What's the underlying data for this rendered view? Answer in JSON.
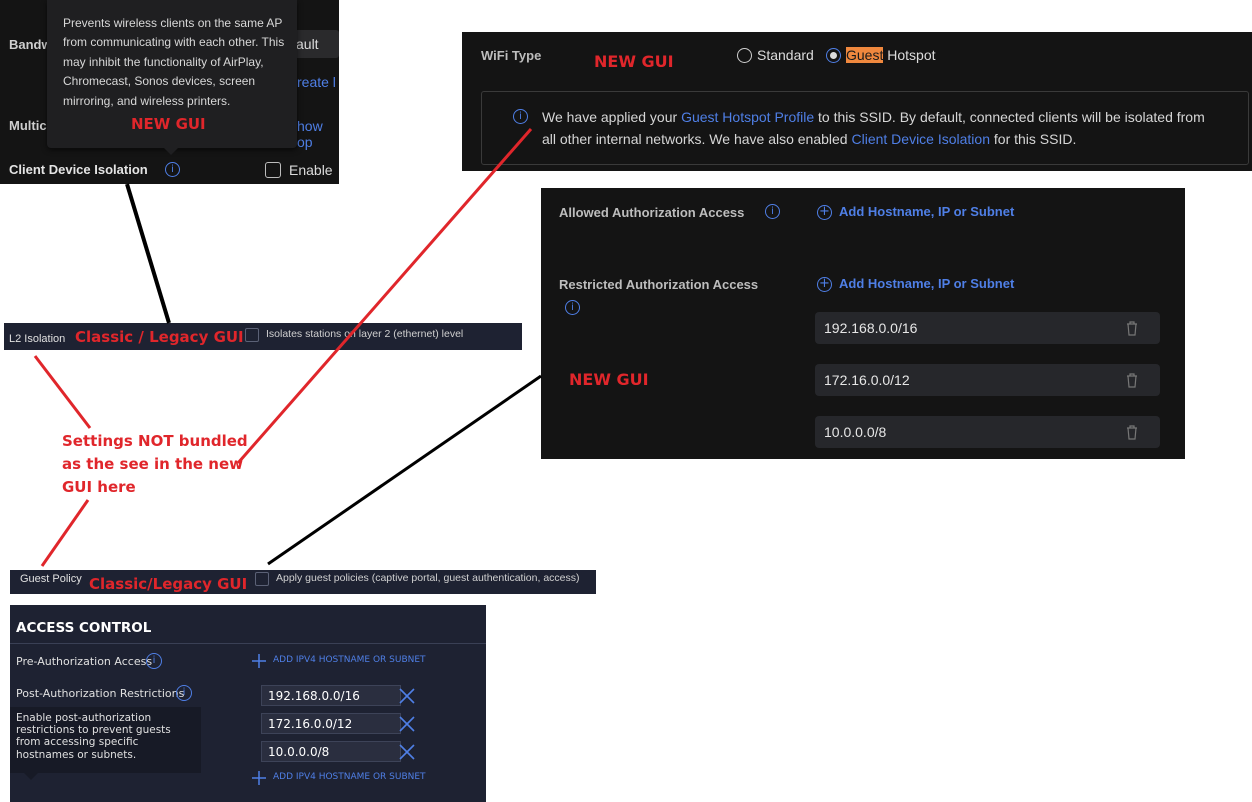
{
  "tooltip": {
    "text": "Prevents wireless clients on the same AP from communicating with each other. This may inhibit the functionality of AirPlay, Chromecast, Sonos devices, screen mirroring, and wireless printers.",
    "annotation": "NEW GUI"
  },
  "new_gui_isolation": {
    "bandwidth_label_partial": "Bandw",
    "default_partial": "ault",
    "create_partial": "reate l",
    "multicast_label_partial": "Multic",
    "show_partial": "how op",
    "client_isolation_label": "Client Device Isolation",
    "enable_label": "Enable"
  },
  "wifi_type": {
    "label": "WiFi Type",
    "annotation": "NEW GUI",
    "option_standard": "Standard",
    "option_guest_highlight": "Guest",
    "option_hotspot": " Hotspot",
    "notice_part1": "We have applied your ",
    "notice_link1": "Guest Hotspot Profile",
    "notice_part2": " to this SSID. By default, connected clients will be isolated from",
    "notice_part3": "all other internal networks. We have also enabled ",
    "notice_link2": "Client Device Isolation",
    "notice_part4": " for this SSID."
  },
  "new_gui_access": {
    "allowed_label": "Allowed Authorization Access",
    "restricted_label": "Restricted Authorization Access",
    "add_label": "Add Hostname, IP or Subnet",
    "annotation": "NEW GUI",
    "subnets": [
      "192.168.0.0/16",
      "172.16.0.0/12",
      "10.0.0.0/8"
    ]
  },
  "legacy_l2": {
    "label": "L2 Isolation",
    "annotation": "Classic / Legacy GUI",
    "checkbox_label": "Isolates stations on layer 2 (ethernet) level"
  },
  "middle_annotation": {
    "line1": "Settings NOT bundled",
    "line2": "as the see in the new",
    "line3": "GUI here"
  },
  "legacy_guest": {
    "label": "Guest Policy",
    "annotation": "Classic/Legacy GUI",
    "checkbox_label": "Apply guest policies (captive portal, guest authentication, access)"
  },
  "legacy_access": {
    "title": "ACCESS CONTROL",
    "pre_auth_label": "Pre-Authorization Access",
    "post_auth_label": "Post-Authorization Restrictions",
    "add_label": "ADD IPV4 HOSTNAME OR SUBNET",
    "tooltip_text": "Enable post-authorization restrictions to prevent guests from accessing specific hostnames or subnets.",
    "subnets": [
      "192.168.0.0/16",
      "172.16.0.0/12",
      "10.0.0.0/8"
    ]
  },
  "colors": {
    "annotation_red": "#e0262b",
    "link_blue": "#4f7fe6",
    "highlight_orange": "#f0883e",
    "legacy_bg": "#1e2232"
  }
}
